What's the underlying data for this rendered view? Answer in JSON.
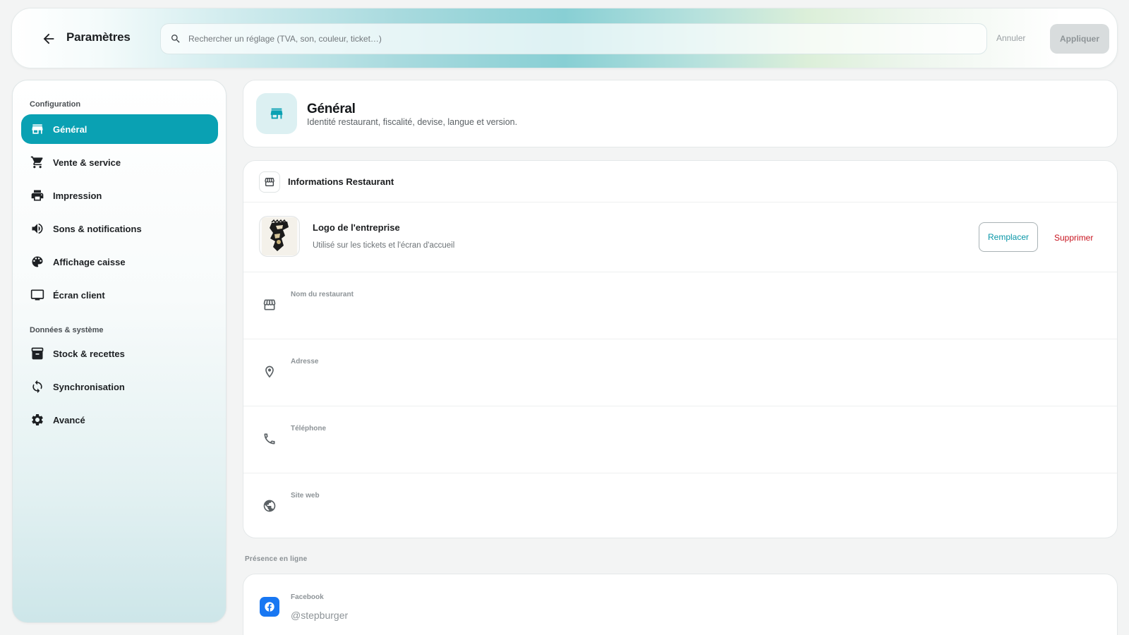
{
  "header": {
    "title": "Paramètres",
    "search_placeholder": "Rechercher un réglage (TVA, son, couleur, ticket…)",
    "cancel_label": "Annuler",
    "apply_label": "Appliquer"
  },
  "sidebar": {
    "section_config": "Configuration",
    "section_data": "Données & système",
    "items": [
      {
        "label": "Général",
        "icon": "store-icon",
        "active": true
      },
      {
        "label": "Vente & service",
        "icon": "cart-icon"
      },
      {
        "label": "Impression",
        "icon": "printer-icon"
      },
      {
        "label": "Sons & notifications",
        "icon": "speaker-icon"
      },
      {
        "label": "Affichage caisse",
        "icon": "palette-icon"
      },
      {
        "label": "Écran client",
        "icon": "monitor-icon"
      },
      {
        "label": "Stock & recettes",
        "icon": "archive-icon"
      },
      {
        "label": "Synchronisation",
        "icon": "sync-icon"
      },
      {
        "label": "Avancé",
        "icon": "gear-icon"
      }
    ]
  },
  "general": {
    "title": "Général",
    "subtitle": "Identité restaurant, fiscalité, devise, langue et version."
  },
  "info": {
    "title": "Informations Restaurant",
    "logo_title": "Logo de l'entreprise",
    "logo_sub": "Utilisé sur les tickets et l'écran d'accueil",
    "replace_label": "Remplacer",
    "delete_label": "Supprimer",
    "fields": [
      {
        "label": "Nom du restaurant",
        "value": "",
        "icon": "store-icon"
      },
      {
        "label": "Adresse",
        "value": "",
        "icon": "location-icon"
      },
      {
        "label": "Téléphone",
        "value": "",
        "icon": "phone-icon"
      },
      {
        "label": "Site web",
        "value": "",
        "icon": "globe-icon"
      }
    ]
  },
  "online": {
    "section_label": "Présence en ligne",
    "facebook_label": "Facebook",
    "facebook_value": "@stepburger"
  },
  "colors": {
    "accent": "#0aa1b3",
    "danger": "#c8141f",
    "facebook": "#1877f2"
  }
}
